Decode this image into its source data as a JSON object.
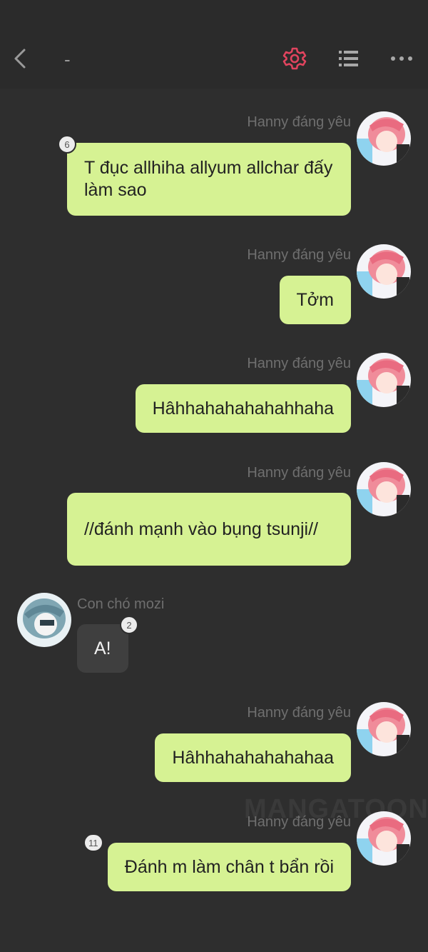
{
  "header": {
    "title": "-"
  },
  "watermark": "MANGATOON",
  "messages": [
    {
      "sender": "Hanny đáng yêu",
      "text": "T đục allhiha allyum allchar đấy làm sao",
      "badge": "6"
    },
    {
      "sender": "Hanny đáng yêu",
      "text": "Tởm"
    },
    {
      "sender": "Hanny đáng yêu",
      "text": "Hâhhahahahahahhaha"
    },
    {
      "sender": "Hanny đáng yêu",
      "text": "//đánh mạnh vào bụng tsunji//"
    },
    {
      "sender": "Con chó mozi",
      "text": "A!",
      "badge": "2"
    },
    {
      "sender": "Hanny đáng yêu",
      "text": "Hâhhahahahahahaa"
    },
    {
      "sender": "Hanny đáng yêu",
      "text": "Đánh m làm chân t bẩn rồi",
      "badge": "11"
    }
  ],
  "icons": {
    "back": "chevron-left-icon",
    "settings": "gear-icon",
    "list": "list-icon",
    "more": "more-horizontal-icon"
  },
  "colors": {
    "background": "#2e2e2e",
    "my_bubble": "#d6f293",
    "their_bubble": "#3f3f3f",
    "accent": "#e0445e"
  }
}
